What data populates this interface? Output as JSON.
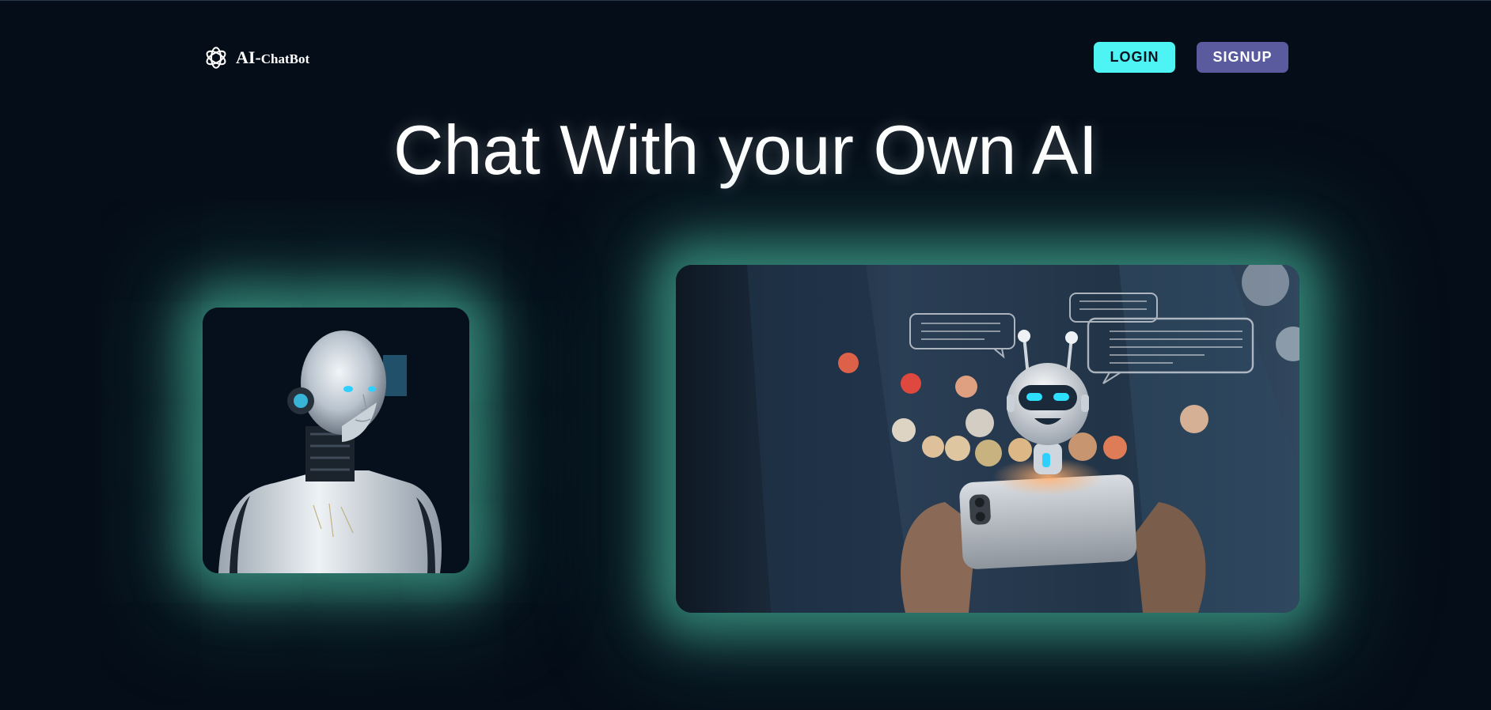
{
  "header": {
    "logo": {
      "icon": "openai-knot-icon",
      "text_big": "AI-",
      "text_small": "ChatBot"
    },
    "login_label": "LOGIN",
    "signup_label": "SIGNUP"
  },
  "hero": {
    "title": "Chat With your Own AI"
  },
  "images": {
    "left": "humanoid-robot-image",
    "right": "chatbot-on-smartphone-image"
  },
  "colors": {
    "background": "#050d18",
    "login_bg": "#4ef3f3",
    "signup_bg": "#5a5b9e",
    "glow": "#50cdaf"
  }
}
